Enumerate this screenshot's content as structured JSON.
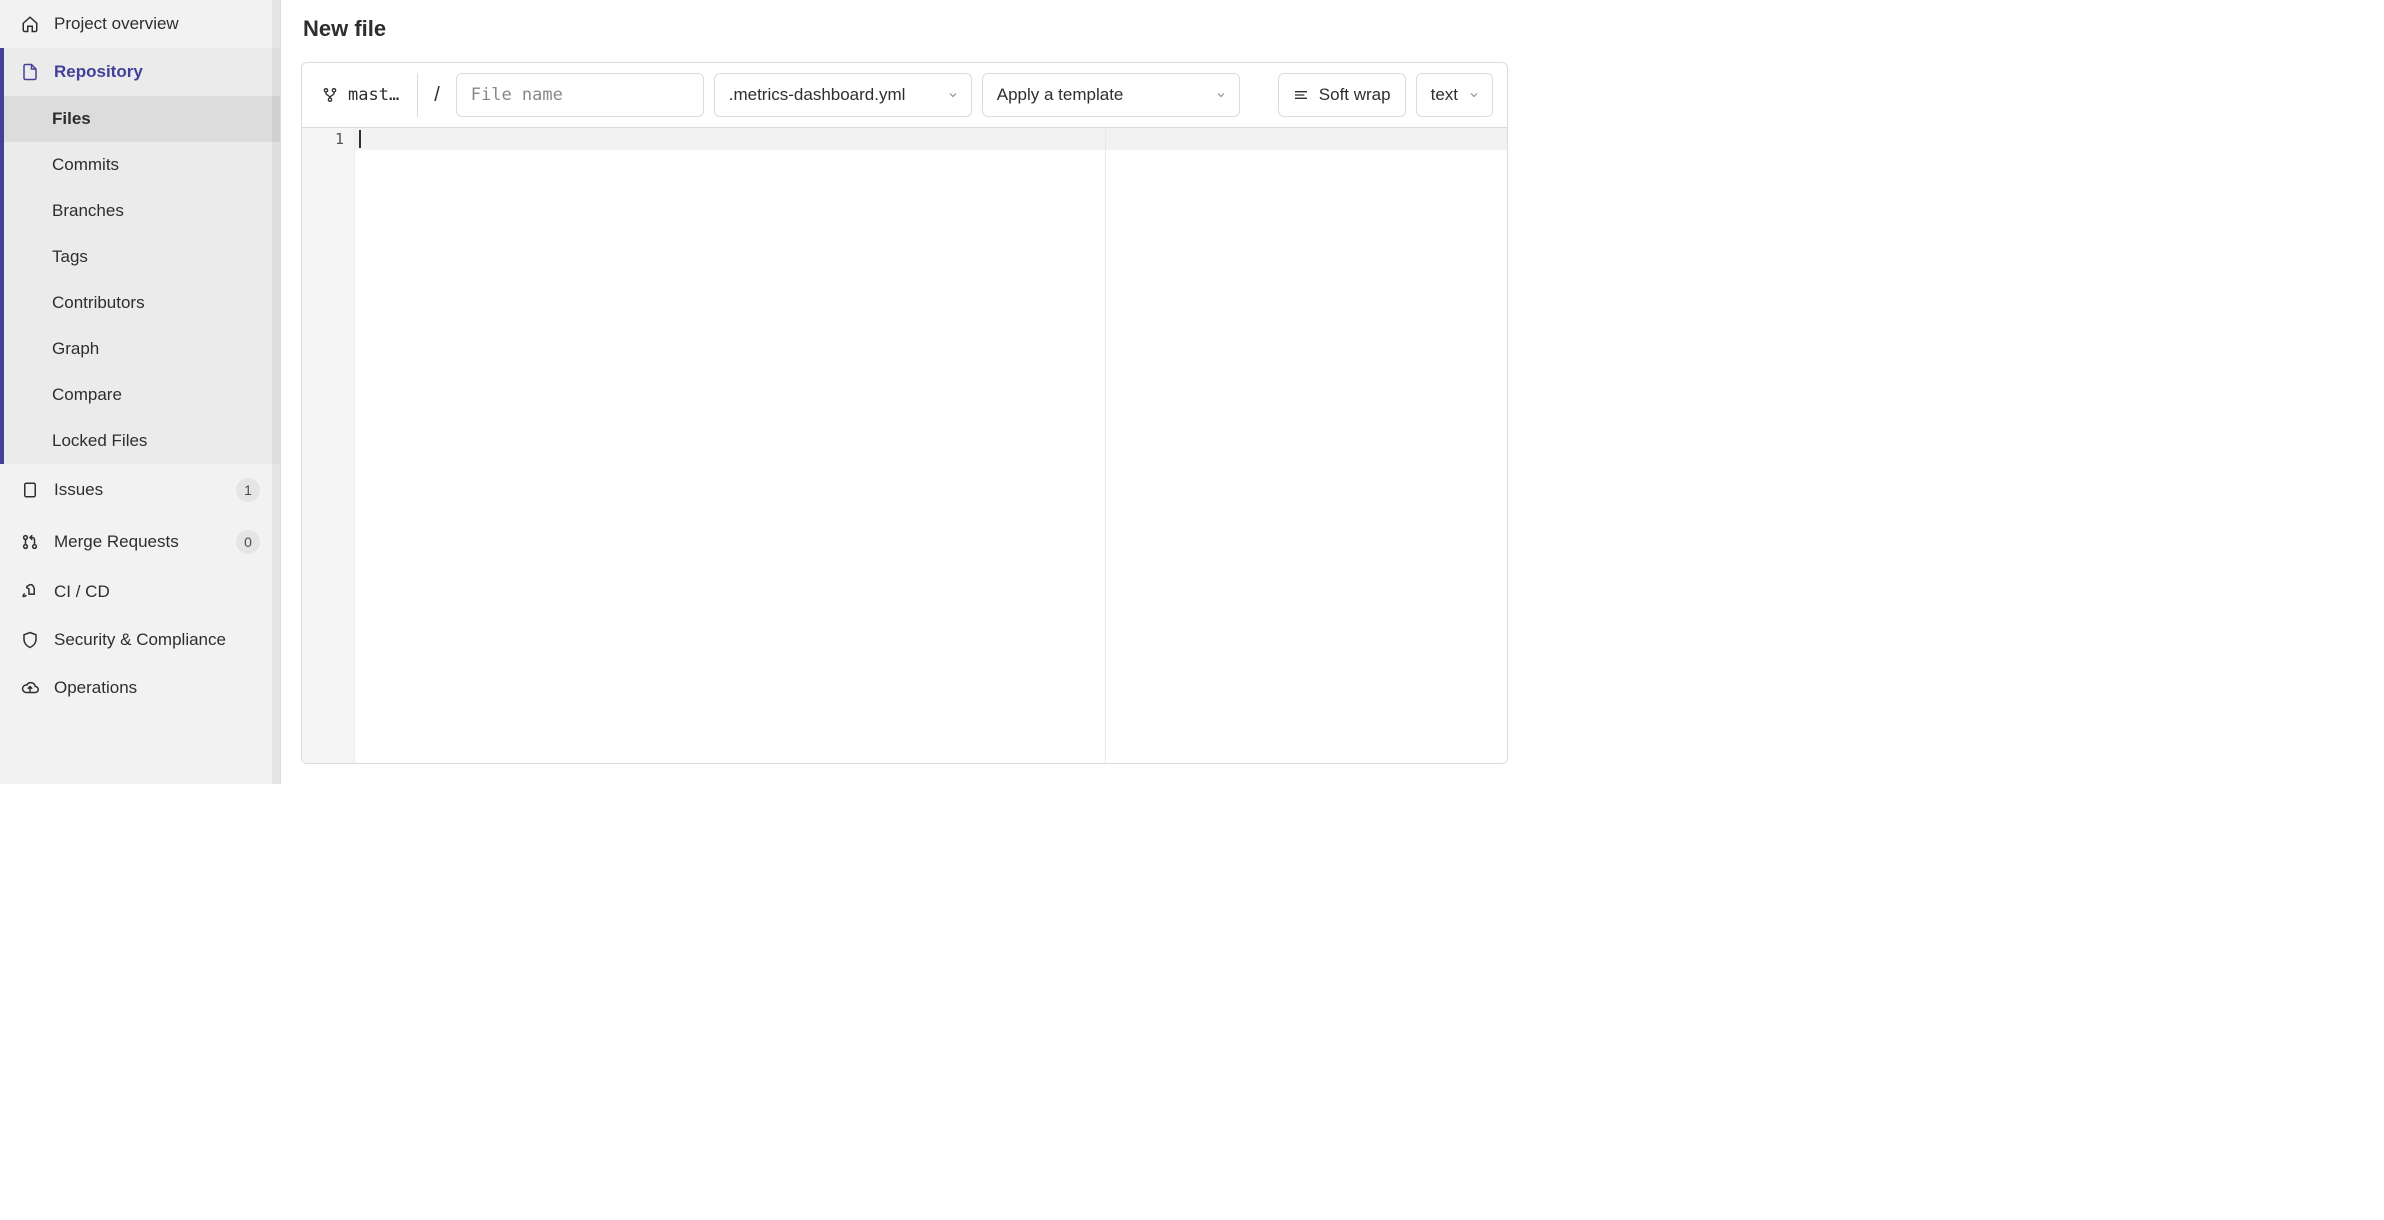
{
  "sidebar": {
    "project_overview": "Project overview",
    "repository": "Repository",
    "repo_sub": {
      "files": "Files",
      "commits": "Commits",
      "branches": "Branches",
      "tags": "Tags",
      "contributors": "Contributors",
      "graph": "Graph",
      "compare": "Compare",
      "locked_files": "Locked Files"
    },
    "issues": "Issues",
    "issues_count": "1",
    "merge_requests": "Merge Requests",
    "mr_count": "0",
    "ci_cd": "CI / CD",
    "security": "Security & Compliance",
    "operations": "Operations"
  },
  "page": {
    "title": "New file"
  },
  "toolbar": {
    "branch": "mast…",
    "path_sep": "/",
    "filename_placeholder": "File name",
    "filename_value": "",
    "template_type": ".metrics-dashboard.yml",
    "apply_template": "Apply a template",
    "soft_wrap": "Soft wrap",
    "syntax": "text"
  },
  "editor": {
    "line_number": "1"
  }
}
